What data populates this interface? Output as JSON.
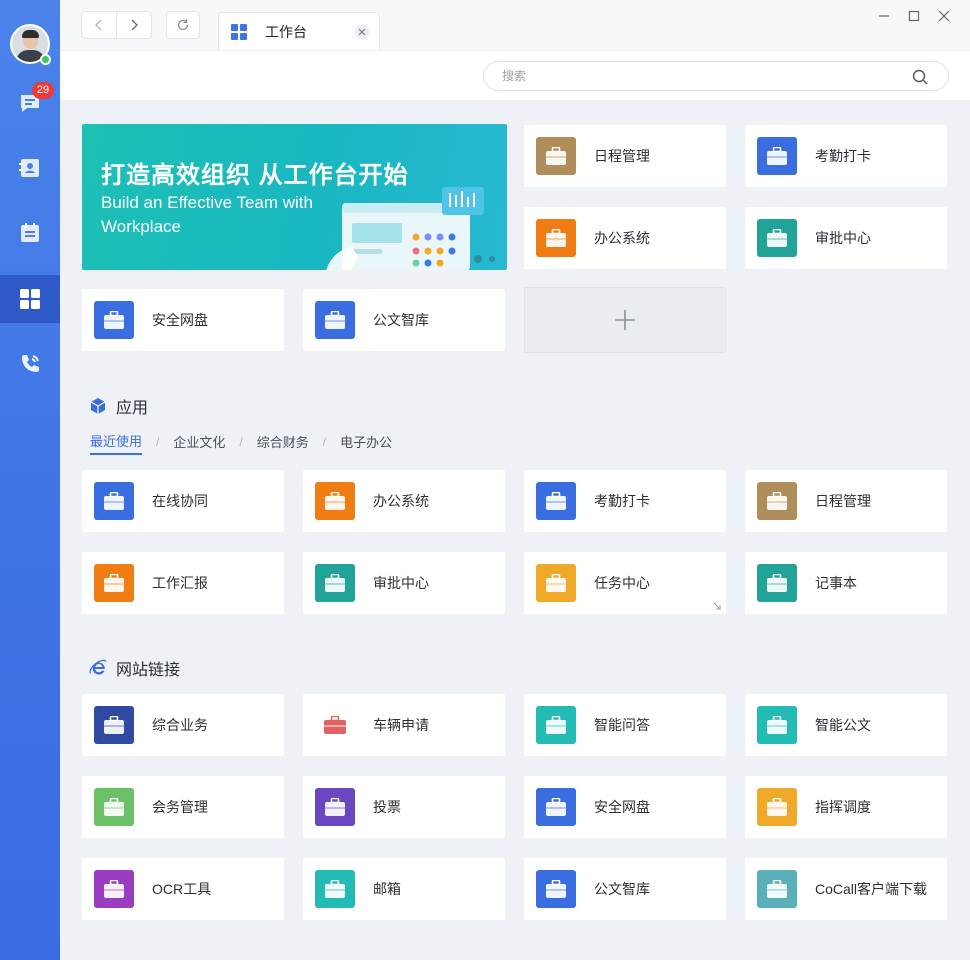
{
  "sidebar": {
    "unread_count": "29",
    "items": [
      {
        "icon": "chat-icon"
      },
      {
        "icon": "contacts-icon"
      },
      {
        "icon": "calendar-icon"
      },
      {
        "icon": "workbench-grid-icon"
      },
      {
        "icon": "phone-call-icon"
      }
    ],
    "accent": "#3f74e6"
  },
  "tab": {
    "label": "工作台"
  },
  "search": {
    "placeholder": "搜索"
  },
  "banner": {
    "title": "打造高效组织 从工作台开始",
    "subtitle": "Build an Effective Team with Workplace"
  },
  "top_cards": [
    {
      "label": "日程管理",
      "color": "#b08e5b"
    },
    {
      "label": "考勤打卡",
      "color": "#3a6ee0"
    },
    {
      "label": "办公系统",
      "color": "#ef7d14"
    },
    {
      "label": "审批中心",
      "color": "#21a39a"
    },
    {
      "label": "安全网盘",
      "color": "#3a6ee0"
    },
    {
      "label": "公文智库",
      "color": "#3a6ee0"
    }
  ],
  "apps": {
    "title": "应用",
    "categories": [
      "最近使用",
      "企业文化",
      "综合财务",
      "电子办公"
    ],
    "items": [
      {
        "label": "在线协同",
        "color": "#3a6ee0"
      },
      {
        "label": "办公系统",
        "color": "#ef7d14"
      },
      {
        "label": "考勤打卡",
        "color": "#3a6ee0"
      },
      {
        "label": "日程管理",
        "color": "#b08e5b"
      },
      {
        "label": "工作汇报",
        "color": "#ef7d14"
      },
      {
        "label": "审批中心",
        "color": "#21a39a"
      },
      {
        "label": "任务中心",
        "color": "#f0a828"
      },
      {
        "label": "记事本",
        "color": "#21a39a"
      }
    ]
  },
  "links": {
    "title": "网站链接",
    "items": [
      {
        "label": "综合业务",
        "color": "#2f4aa0"
      },
      {
        "label": "车辆申请",
        "color": "#e06262"
      },
      {
        "label": "智能问答",
        "color": "#22bcb4"
      },
      {
        "label": "智能公文",
        "color": "#22bcb4"
      },
      {
        "label": "会务管理",
        "color": "#6cc066"
      },
      {
        "label": "投票",
        "color": "#6a46c0"
      },
      {
        "label": "安全网盘",
        "color": "#3a6ee0"
      },
      {
        "label": "指挥调度",
        "color": "#f0a828"
      },
      {
        "label": "OCR工具",
        "color": "#9a3cc0"
      },
      {
        "label": "邮箱",
        "color": "#22bcb4"
      },
      {
        "label": "公文智库",
        "color": "#3a6ee0"
      },
      {
        "label": "CoCall客户端下载",
        "color": "#5ab0b8"
      }
    ]
  }
}
